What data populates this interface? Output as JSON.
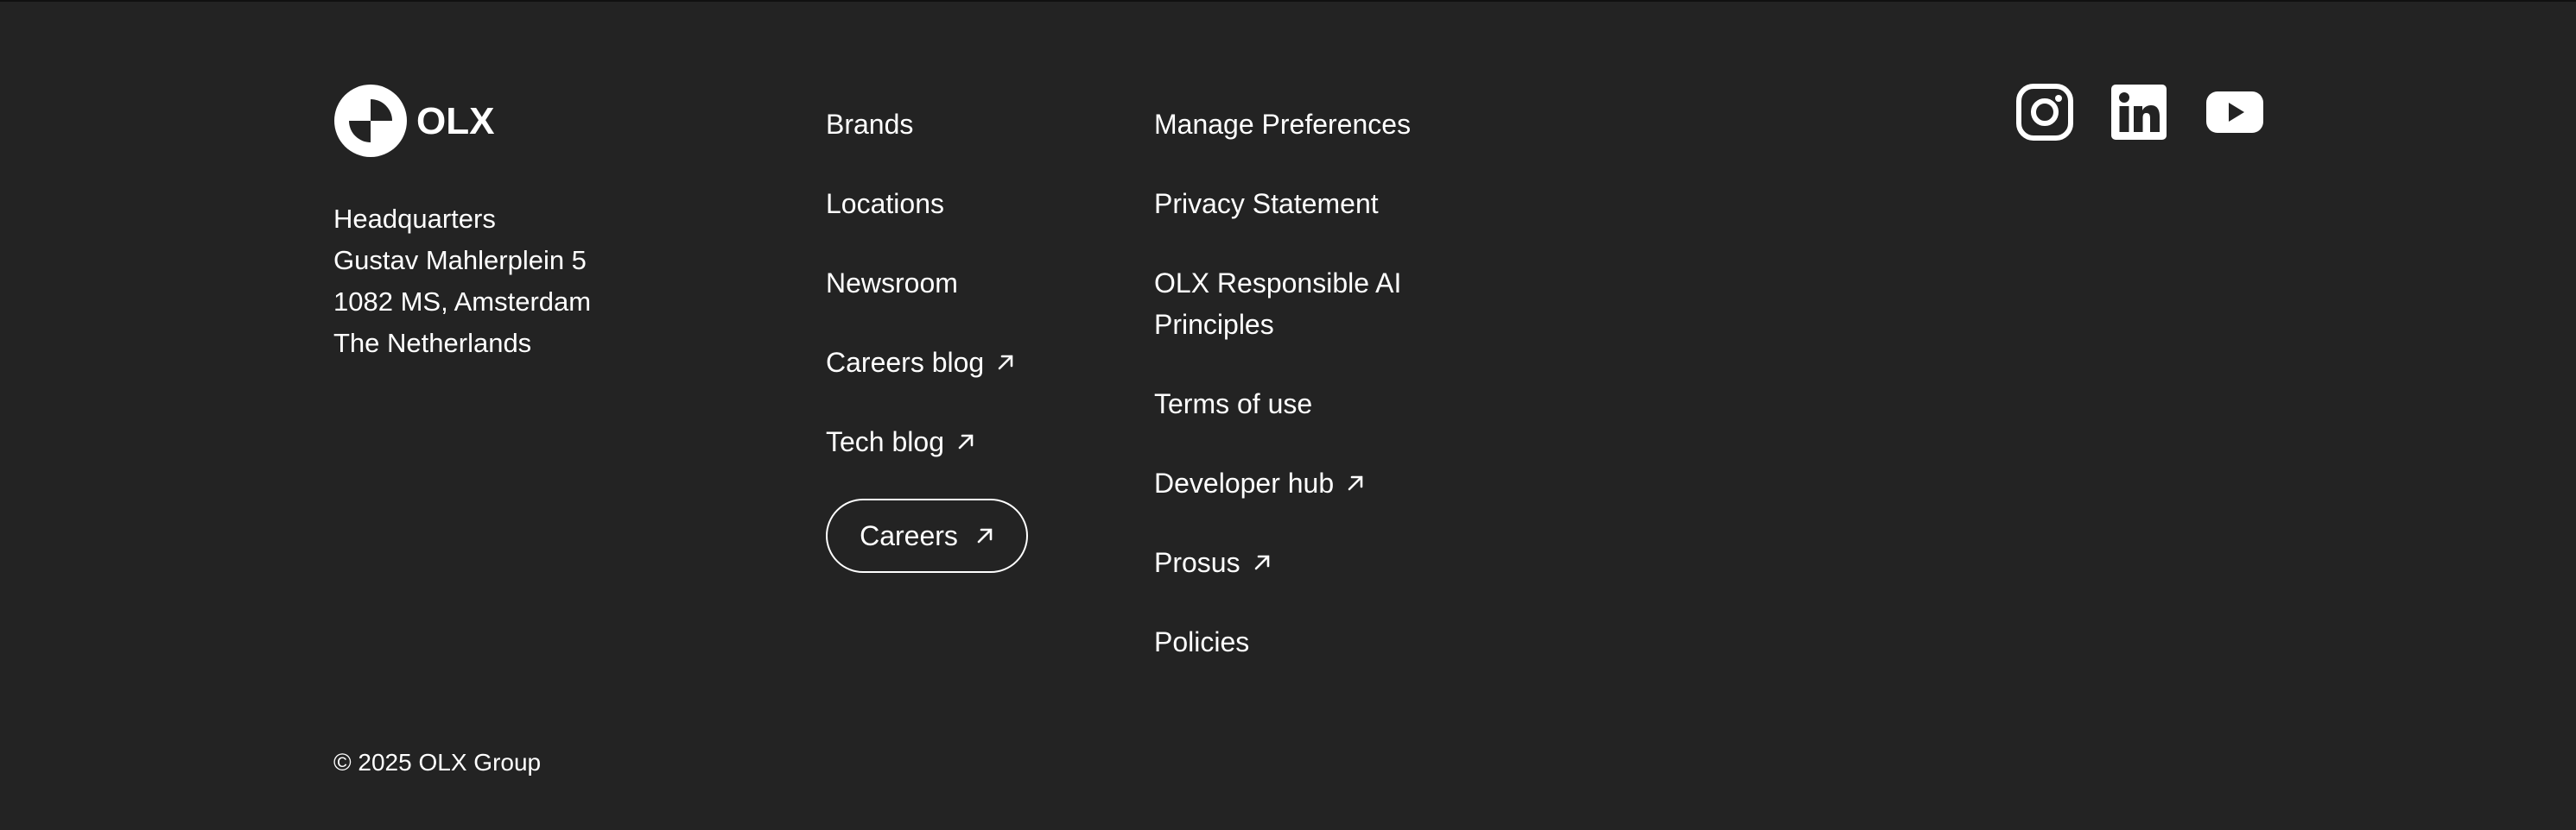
{
  "brand": {
    "logo_text": "OLX"
  },
  "address": {
    "lines": [
      "Headquarters",
      "Gustav Mahlerplein 5",
      "1082 MS, Amsterdam",
      "The Netherlands"
    ]
  },
  "nav_col1": {
    "brands": "Brands",
    "locations": "Locations",
    "newsroom": "Newsroom",
    "careers_blog": "Careers blog",
    "tech_blog": "Tech blog",
    "careers_button": "Careers"
  },
  "nav_col2": {
    "manage_preferences": "Manage Preferences",
    "privacy_statement": "Privacy Statement",
    "responsible_ai_line1": "OLX Responsible AI",
    "responsible_ai_line2": "Principles",
    "terms_of_use": "Terms of use",
    "developer_hub": "Developer hub",
    "prosus": "Prosus",
    "policies": "Policies"
  },
  "social": {
    "icons": [
      "instagram-icon",
      "linkedin-icon",
      "youtube-icon"
    ]
  },
  "footer": {
    "copyright": "© 2025 OLX Group"
  },
  "colors": {
    "background": "#232323",
    "text": "#ffffff"
  }
}
